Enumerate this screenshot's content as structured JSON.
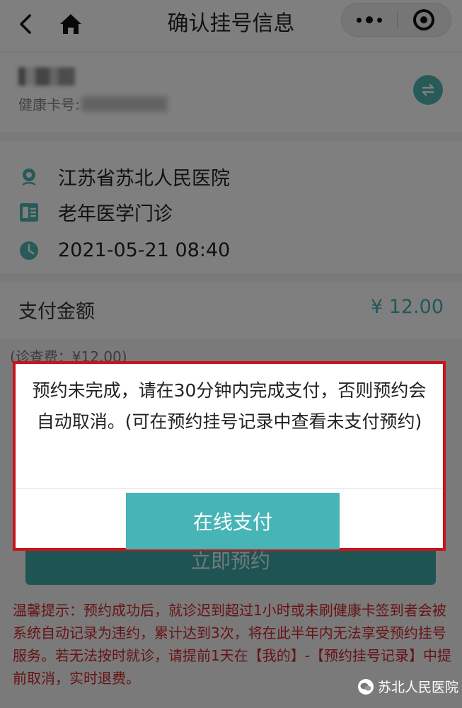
{
  "header": {
    "title": "确认挂号信息"
  },
  "patient": {
    "card_label": "健康卡号:"
  },
  "appointment": {
    "hospital": "江苏省苏北人民医院",
    "department": "老年医学门诊",
    "datetime": "2021-05-21 08:40"
  },
  "payment": {
    "label": "支付金额",
    "amount": "¥ 12.00",
    "fee_note": "(诊查费：¥12.00)"
  },
  "book_button_label": "立即预约",
  "modal": {
    "message": "预约未完成，请在30分钟内完成支付，否则预约会自动取消。(可在预约挂号记录中查看未支付预约)",
    "button_label": "在线支付"
  },
  "tips": "温馨提示：预约成功后，就诊迟到超过1小时或未刷健康卡签到者会被系统自动记录为违约，累计达到3次，将在此半年内无法享受预约挂号服务。若无法按时就诊，请提前1天在【我的】-【预约挂号记录】中提前取消，实时退费。",
  "watermark": "苏北人民医院",
  "colors": {
    "accent": "#46aeb0",
    "warning": "#d0262a",
    "modal_border": "#c8141a"
  }
}
